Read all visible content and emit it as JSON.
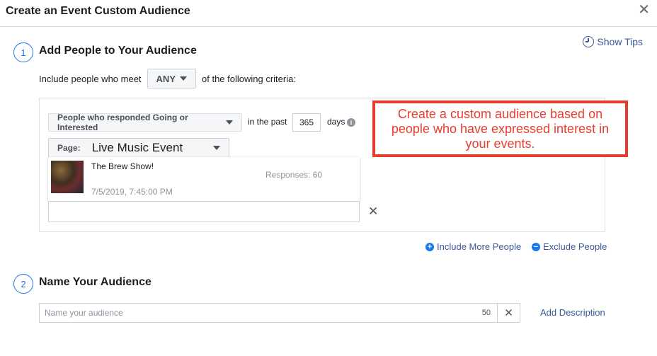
{
  "dialog": {
    "title": "Create an Event Custom Audience",
    "close_label": "✕",
    "show_tips": "Show Tips"
  },
  "step1": {
    "number": "1",
    "title": "Add People to Your Audience",
    "include_prefix": "Include people who meet",
    "match_value": "ANY",
    "include_suffix": "of the following criteria:"
  },
  "rule": {
    "responded": "People who responded Going or Interested",
    "in_past": "in the past",
    "days_value": "365",
    "days_label": "days",
    "info_icon_glyph": "i",
    "page_label": "Page:",
    "page_value": "Live Music Event",
    "event": {
      "name": "The Brew Show!",
      "date": "7/5/2019, 7:45:00 PM",
      "responses": "Responses: 60"
    },
    "remove_label": "✕"
  },
  "callout": {
    "lines": [
      "Create a custom audience based on",
      "people who have expressed interest in",
      "your events."
    ],
    "color": "#e73d2d"
  },
  "links": {
    "include_more": "Include More People",
    "exclude": "Exclude People"
  },
  "step2": {
    "number": "2",
    "title": "Name Your Audience",
    "name_placeholder": "Name your audience",
    "char_count": "50",
    "clear_label": "✕",
    "add_description": "Add Description"
  },
  "colors": {
    "accent_blue": "#1877f2",
    "link_blue": "#385898",
    "callout_red": "#e73d2d"
  }
}
